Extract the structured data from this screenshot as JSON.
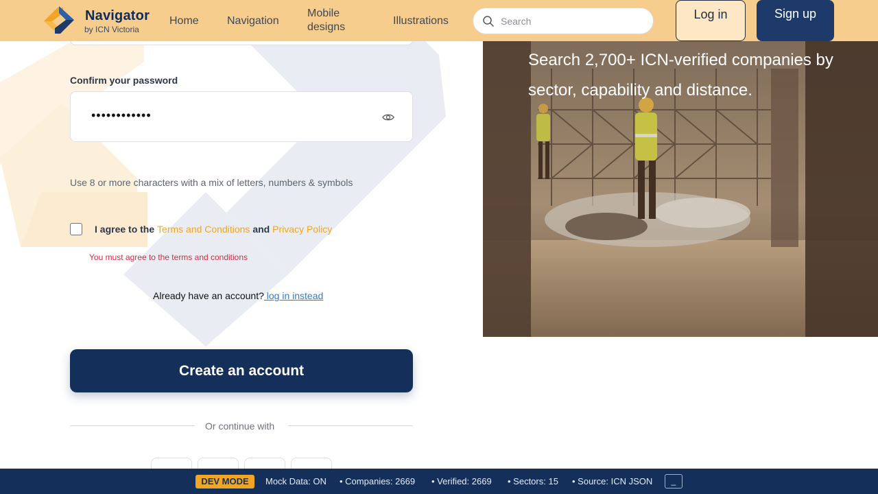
{
  "header": {
    "brand_name": "Navigator",
    "brand_sub": "by ICN Victoria",
    "nav": {
      "home": "Home",
      "navigation": "Navigation",
      "mobile_designs": "Mobile designs",
      "illustrations": "Illustrations"
    },
    "search_placeholder": "Search",
    "login_label": "Log in",
    "signup_label": "Sign up"
  },
  "form": {
    "confirm_label": "Confirm your password",
    "confirm_value": "••••••••••••",
    "hint": "Use 8 or more characters with a mix of letters, numbers & symbols",
    "agree_prefix": "I agree to the ",
    "terms_link": "Terms and Conditions",
    "agree_and": " and ",
    "privacy_link": "Privacy Policy",
    "error": "You must agree to the terms and conditions",
    "already_text": "Already have an account?",
    "login_link": " log in instead",
    "submit_label": "Create an account",
    "divider": "Or continue with"
  },
  "hero": {
    "tagline": "Search 2,700+ ICN-verified companies by sector, capability and distance."
  },
  "devbar": {
    "badge": "DEV MODE",
    "mock": "Mock Data: ON",
    "companies": "• Companies: 2669",
    "verified": "• Verified: 2669",
    "sectors": "• Sectors: 15",
    "source": "• Source: ICN JSON",
    "minimize": "_"
  },
  "colors": {
    "header_bg": "#f7cd8d",
    "primary": "#14305a",
    "accent": "#f0a524",
    "error": "#d62a3e",
    "link": "#2f7bd6"
  },
  "icons": [
    "logo-icon",
    "search-icon",
    "eye-icon"
  ]
}
